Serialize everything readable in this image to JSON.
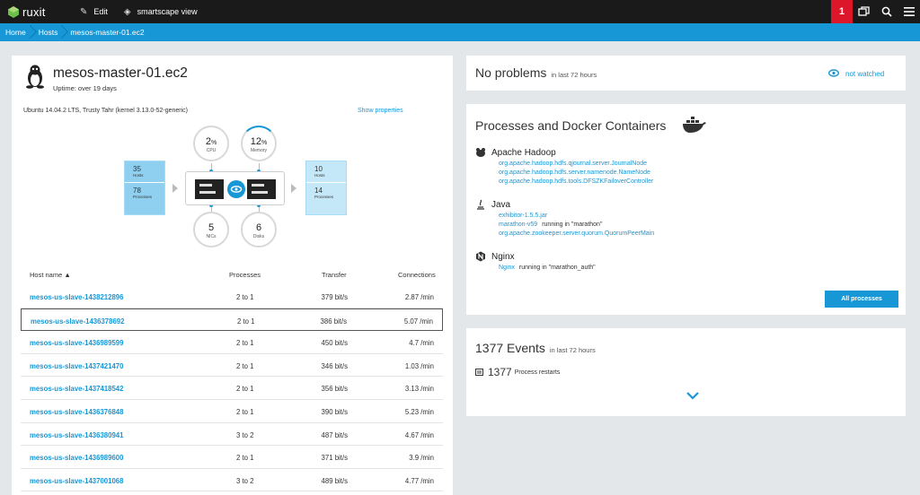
{
  "topbar": {
    "logo": "ruxit",
    "edit_label": "Edit",
    "smartscape_label": "smartscape view",
    "alert_count": "1"
  },
  "breadcrumb": {
    "items": [
      "Home",
      "Hosts",
      "mesos-master-01.ec2"
    ]
  },
  "host": {
    "name": "mesos-master-01.ec2",
    "uptime": "Uptime: over 19 days",
    "os": "Ubuntu 14.04.2 LTS, Trusty Tahr (kernel 3.13.0-52-generic)",
    "show_properties": "Show properties",
    "cpu": {
      "value": "2",
      "unit": "%",
      "label": "CPU"
    },
    "memory": {
      "value": "12",
      "unit": "%",
      "label": "Memory"
    },
    "nics": {
      "value": "5",
      "label": "NICs"
    },
    "disks": {
      "value": "6",
      "label": "Disks"
    },
    "incoming": {
      "hosts": "35",
      "hosts_label": "Hosts",
      "processes": "78",
      "processes_label": "Processes"
    },
    "outgoing": {
      "hosts": "10",
      "hosts_label": "Hosts",
      "processes": "14",
      "processes_label": "Processes"
    }
  },
  "table": {
    "headers": {
      "host": "Host name ▲",
      "processes": "Processes",
      "transfer": "Transfer",
      "connections": "Connections"
    },
    "rows": [
      {
        "host": "mesos-us-slave-1438212896",
        "processes": "2 to 1",
        "transfer": "379 bit/s",
        "connections": "2.87 /min"
      },
      {
        "host": "mesos-us-slave-1436378692",
        "processes": "2 to 1",
        "transfer": "386 bit/s",
        "connections": "5.07 /min"
      },
      {
        "host": "mesos-us-slave-1436989599",
        "processes": "2 to 1",
        "transfer": "450 bit/s",
        "connections": "4.7 /min"
      },
      {
        "host": "mesos-us-slave-1437421470",
        "processes": "2 to 1",
        "transfer": "346 bit/s",
        "connections": "1.03 /min"
      },
      {
        "host": "mesos-us-slave-1437418542",
        "processes": "2 to 1",
        "transfer": "356 bit/s",
        "connections": "3.13 /min"
      },
      {
        "host": "mesos-us-slave-1436376848",
        "processes": "2 to 1",
        "transfer": "390 bit/s",
        "connections": "5.23 /min"
      },
      {
        "host": "mesos-us-slave-1436380941",
        "processes": "3 to 2",
        "transfer": "487 bit/s",
        "connections": "4.67 /min"
      },
      {
        "host": "mesos-us-slave-1436989600",
        "processes": "2 to 1",
        "transfer": "371 bit/s",
        "connections": "3.9 /min"
      },
      {
        "host": "mesos-us-slave-1437001068",
        "processes": "3 to 2",
        "transfer": "489 bit/s",
        "connections": "4.77 /min"
      }
    ]
  },
  "problems": {
    "title": "No problems",
    "period": "in last 72 hours",
    "watch": "not watched"
  },
  "processes": {
    "title": "Processes and Docker Containers",
    "groups": [
      {
        "name": "Apache Hadoop",
        "items": [
          {
            "name": "org.apache.hadoop.hdfs.qjournal.server.JournalNode",
            "note": ""
          },
          {
            "name": "org.apache.hadoop.hdfs.server.namenode.NameNode",
            "note": ""
          },
          {
            "name": "org.apache.hadoop.hdfs.tools.DFSZKFailoverController",
            "note": ""
          }
        ]
      },
      {
        "name": "Java",
        "items": [
          {
            "name": "exhibitor-1.5.5.jar",
            "note": ""
          },
          {
            "name": "marathon-v59",
            "note": "running in \"marathon\""
          },
          {
            "name": "org.apache.zookeeper.server.quorum.QuorumPeerMain",
            "note": ""
          }
        ]
      },
      {
        "name": "Nginx",
        "items": [
          {
            "name": "Nginx",
            "note": "running in \"marathon_auth\""
          }
        ]
      }
    ],
    "all_button": "All processes"
  },
  "events": {
    "count": "1377",
    "title": "Events",
    "period": "in last 72 hours",
    "restart_count": "1377",
    "restart_label": "Process restarts"
  },
  "colors": {
    "accent": "#1797d6",
    "alert": "#dc172a",
    "topbar": "#1a1a1a"
  }
}
